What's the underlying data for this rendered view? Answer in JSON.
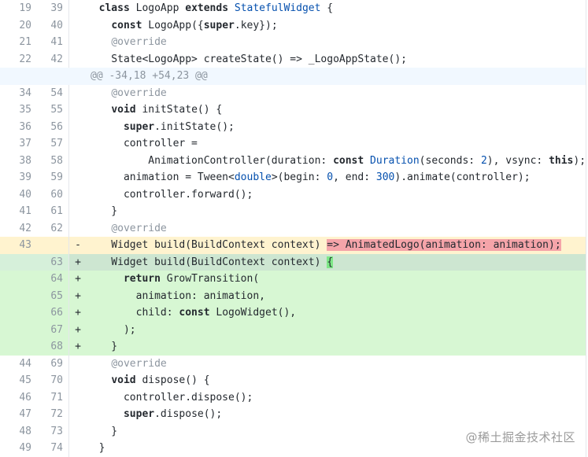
{
  "diff": {
    "hunk_header": "@@ -34,18 +54,23 @@",
    "lines": [
      {
        "old": "19",
        "new": "39",
        "sign": "",
        "type": "ctx",
        "code": "  class LogoApp extends StatefulWidget {"
      },
      {
        "old": "20",
        "new": "40",
        "sign": "",
        "type": "ctx",
        "code": "    const LogoApp({super.key});"
      },
      {
        "old": "21",
        "new": "41",
        "sign": "",
        "type": "ctx",
        "code": "    @override"
      },
      {
        "old": "22",
        "new": "42",
        "sign": "",
        "type": "ctx",
        "code": "    State<LogoApp> createState() => _LogoAppState();"
      },
      {
        "old": "",
        "new": "",
        "sign": "",
        "type": "hunk",
        "code": "@@ -34,18 +54,23 @@"
      },
      {
        "old": "34",
        "new": "54",
        "sign": "",
        "type": "ctx",
        "code": "    @override"
      },
      {
        "old": "35",
        "new": "55",
        "sign": "",
        "type": "ctx",
        "code": "    void initState() {"
      },
      {
        "old": "36",
        "new": "56",
        "sign": "",
        "type": "ctx",
        "code": "      super.initState();"
      },
      {
        "old": "37",
        "new": "57",
        "sign": "",
        "type": "ctx",
        "code": "      controller ="
      },
      {
        "old": "38",
        "new": "58",
        "sign": "",
        "type": "ctx",
        "code": "          AnimationController(duration: const Duration(seconds: 2), vsync: this);"
      },
      {
        "old": "39",
        "new": "59",
        "sign": "",
        "type": "ctx",
        "code": "      animation = Tween<double>(begin: 0, end: 300).animate(controller);"
      },
      {
        "old": "40",
        "new": "60",
        "sign": "",
        "type": "ctx",
        "code": "      controller.forward();"
      },
      {
        "old": "41",
        "new": "61",
        "sign": "",
        "type": "ctx",
        "code": "    }"
      },
      {
        "old": "42",
        "new": "62",
        "sign": "",
        "type": "ctx",
        "code": "    @override"
      },
      {
        "old": "43",
        "new": "",
        "sign": "-",
        "type": "del",
        "code": "    Widget build(BuildContext context) => AnimatedLogo(animation: animation);"
      },
      {
        "old": "",
        "new": "63",
        "sign": "+",
        "type": "add-first",
        "code": "    Widget build(BuildContext context) {"
      },
      {
        "old": "",
        "new": "64",
        "sign": "+",
        "type": "add",
        "code": "      return GrowTransition("
      },
      {
        "old": "",
        "new": "65",
        "sign": "+",
        "type": "add",
        "code": "        animation: animation,"
      },
      {
        "old": "",
        "new": "66",
        "sign": "+",
        "type": "add",
        "code": "        child: const LogoWidget(),"
      },
      {
        "old": "",
        "new": "67",
        "sign": "+",
        "type": "add",
        "code": "      );"
      },
      {
        "old": "",
        "new": "68",
        "sign": "+",
        "type": "add",
        "code": "    }"
      },
      {
        "old": "44",
        "new": "69",
        "sign": "",
        "type": "ctx",
        "code": "    @override"
      },
      {
        "old": "45",
        "new": "70",
        "sign": "",
        "type": "ctx",
        "code": "    void dispose() {"
      },
      {
        "old": "46",
        "new": "71",
        "sign": "",
        "type": "ctx",
        "code": "      controller.dispose();"
      },
      {
        "old": "47",
        "new": "72",
        "sign": "",
        "type": "ctx",
        "code": "      super.dispose();"
      },
      {
        "old": "48",
        "new": "73",
        "sign": "",
        "type": "ctx",
        "code": "    }"
      },
      {
        "old": "49",
        "new": "74",
        "sign": "",
        "type": "ctx",
        "code": "  }"
      }
    ]
  },
  "watermark": "@稀土掘金技术社区",
  "colors": {
    "deleted_bg": "#fff3cf",
    "deleted_highlight": "#f5a4a9",
    "added_bg": "#d7f7d3",
    "added_highlight": "#7ee787",
    "hunk_bg": "#f1f8ff"
  }
}
